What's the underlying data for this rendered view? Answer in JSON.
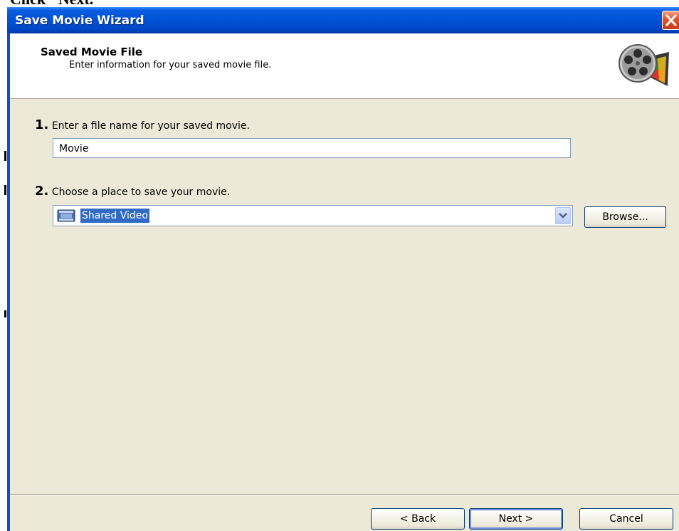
{
  "background": {
    "caption": "Click \"Next.\""
  },
  "window": {
    "title": "Save Movie Wizard",
    "close_label": "Close",
    "header": {
      "title": "Saved Movie File",
      "subtitle": "Enter information for your saved movie file.",
      "icon": "movie-maker-film-reel-icon"
    },
    "step1": {
      "number": "1.",
      "label": "Enter a file name for your saved movie.",
      "input_value": "Movie"
    },
    "step2": {
      "number": "2.",
      "label": "Choose a place to save your movie.",
      "selected_value": "Shared Video",
      "selected_icon": "shared-video-folder-icon",
      "browse_label": "Browse..."
    },
    "buttons": {
      "back_label": "< Back",
      "next_label": "Next >",
      "cancel_label": "Cancel"
    }
  },
  "colors": {
    "titlebar": "#0052d6",
    "dialog_background": "#ece9d8",
    "selection": "#316ac5",
    "close_button": "#e2572f"
  }
}
